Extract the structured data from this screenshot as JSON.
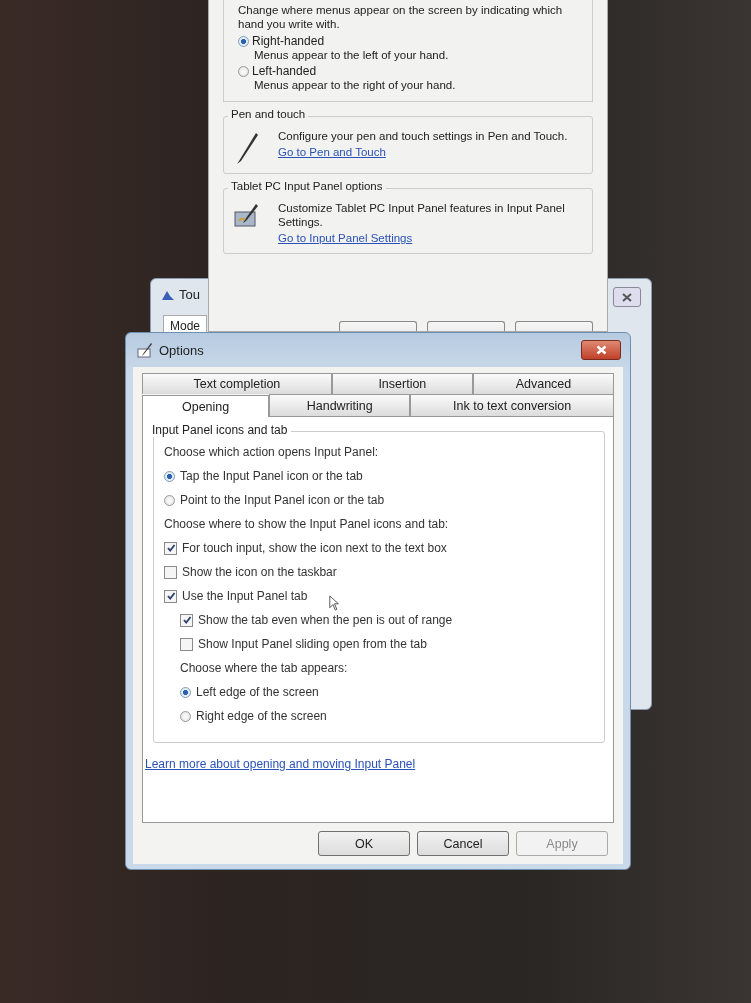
{
  "back_window": {
    "intro": "Change where menus appear on the screen by indicating which hand you write with.",
    "handedness": [
      {
        "label": "Right-handed",
        "description": "Menus appear to the left of your hand.",
        "selected": true
      },
      {
        "label": "Left-handed",
        "description": "Menus appear to the right of your hand.",
        "selected": false
      }
    ],
    "pen_touch": {
      "title": "Pen and touch",
      "text": "Configure your pen and touch settings in Pen and Touch.",
      "link": "Go to Pen and Touch"
    },
    "input_panel": {
      "title": "Tablet PC Input Panel options",
      "text": "Customize Tablet PC Input Panel features in Input Panel Settings.",
      "link": "Go to Input Panel Settings"
    }
  },
  "middle_window": {
    "title": "Tou",
    "tab": "Mode"
  },
  "options_dialog": {
    "title": "Options",
    "tab_rows": [
      [
        {
          "label": "Text completion",
          "selected": false
        },
        {
          "label": "Insertion",
          "selected": false
        },
        {
          "label": "Advanced",
          "selected": false
        }
      ],
      [
        {
          "label": "Opening",
          "selected": true
        },
        {
          "label": "Handwriting",
          "selected": false
        },
        {
          "label": "Ink to text conversion",
          "selected": false
        }
      ]
    ],
    "group_title": "Input Panel icons and tab",
    "items": [
      {
        "kind": "heading",
        "label": "Choose which action opens Input Panel:"
      },
      {
        "kind": "radio",
        "label": "Tap the Input Panel icon or the tab",
        "selected": true
      },
      {
        "kind": "radio",
        "label": "Point to the Input Panel icon or the tab",
        "selected": false
      },
      {
        "kind": "heading",
        "label": "Choose where to show the Input Panel icons and tab:"
      },
      {
        "kind": "checkbox",
        "label": "For touch input, show the icon next to the text box",
        "checked": true
      },
      {
        "kind": "checkbox",
        "label": "Show the icon on the taskbar",
        "checked": false
      },
      {
        "kind": "checkbox",
        "label": "Use the Input Panel tab",
        "checked": true,
        "children": [
          {
            "kind": "checkbox",
            "label": "Show the tab even when the pen is out of range",
            "checked": true
          },
          {
            "kind": "checkbox",
            "label": "Show Input Panel sliding open from the tab",
            "checked": false
          },
          {
            "kind": "heading",
            "label": "Choose where the tab appears:"
          },
          {
            "kind": "radio",
            "label": "Left edge of the screen",
            "selected": true
          },
          {
            "kind": "radio",
            "label": "Right edge of the screen",
            "selected": false
          }
        ]
      }
    ],
    "link": "Learn more about opening and moving Input Panel",
    "buttons": [
      {
        "label": "OK",
        "disabled": false
      },
      {
        "label": "Cancel",
        "disabled": false
      },
      {
        "label": "Apply",
        "disabled": true
      }
    ]
  }
}
